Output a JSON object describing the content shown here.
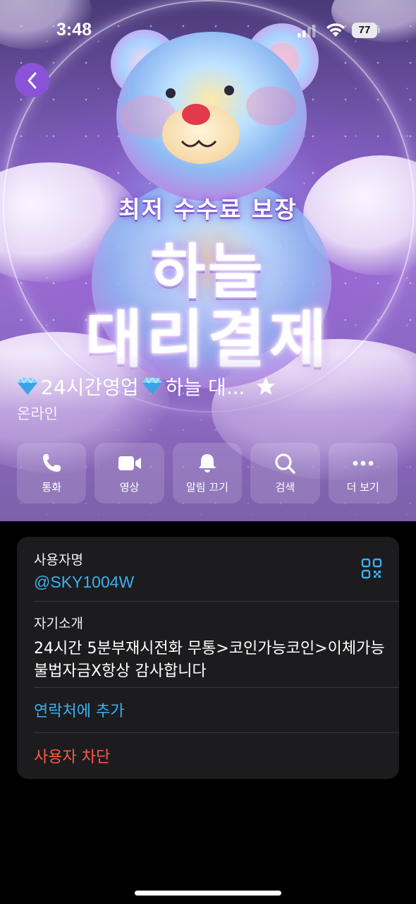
{
  "status_bar": {
    "time": "3:48",
    "battery": "77"
  },
  "cover": {
    "subtitle": "최저 수수료 보장",
    "title_line1": "하늘",
    "title_line2": "대리결제"
  },
  "profile": {
    "name": "24시간영업",
    "name_rest": "하늘 대...",
    "presence": "온라인"
  },
  "actions": [
    {
      "label": "통화",
      "icon": "phone-icon"
    },
    {
      "label": "영상",
      "icon": "video-icon"
    },
    {
      "label": "알림 끄기",
      "icon": "bell-icon"
    },
    {
      "label": "검색",
      "icon": "search-icon"
    },
    {
      "label": "더 보기",
      "icon": "more-icon"
    }
  ],
  "info": {
    "username_label": "사용자명",
    "username": "@SKY1004W",
    "bio_label": "자기소개",
    "bio": "24시간 5분부재시전화 무통>코인가능코인>이체가능불법자금X항상 감사합니다",
    "add_contact": "연락처에 추가",
    "block_user": "사용자 차단"
  },
  "colors": {
    "accent_blue": "#3bb0f0",
    "danger_red": "#ff5a47",
    "card_bg": "#1c1c1e",
    "back_button": "#8a52d6"
  }
}
